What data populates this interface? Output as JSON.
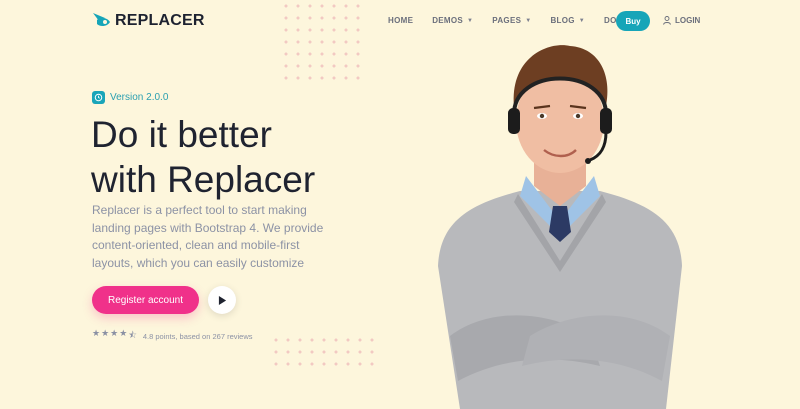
{
  "brand": {
    "name": "REPLACER",
    "accent": "#16a5b8"
  },
  "nav": {
    "items": [
      {
        "label": "HOME",
        "dropdown": false
      },
      {
        "label": "DEMOS",
        "dropdown": true
      },
      {
        "label": "PAGES",
        "dropdown": true
      },
      {
        "label": "BLOG",
        "dropdown": true
      },
      {
        "label": "DOCS",
        "dropdown": true
      }
    ],
    "buy_label": "Buy",
    "login_label": "LOGIN"
  },
  "hero": {
    "version": "Version 2.0.0",
    "headline_line1": "Do it better",
    "headline_line2": "with Replacer",
    "description": "Replacer is a perfect tool to start making landing pages with Bootstrap 4. We provide content-oriented, clean and mobile-first layouts, which you can easily customize",
    "cta_label": "Register account",
    "cta_color": "#f0318a",
    "rating_text": "4.8 points, based on 267 reviews",
    "rating_stars": 4.5
  }
}
